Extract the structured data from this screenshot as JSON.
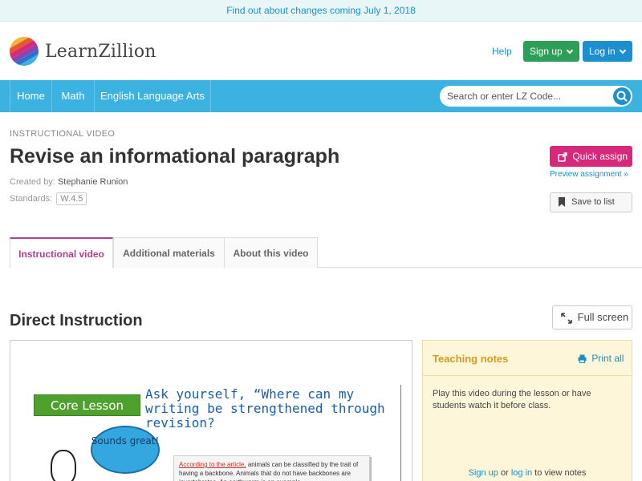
{
  "banner": {
    "text": "Find out about changes coming July 1, 2018"
  },
  "header": {
    "logo_text": "LearnZillion",
    "help": "Help",
    "signup": "Sign up",
    "login": "Log in"
  },
  "nav": {
    "items": [
      "Home",
      "Math",
      "English Language Arts"
    ],
    "search_placeholder": "Search or enter LZ Code..."
  },
  "lesson": {
    "eyebrow": "INSTRUCTIONAL VIDEO",
    "title": "Revise an informational paragraph",
    "created_label": "Created by:",
    "created_by": "Stephanie Runion",
    "standards_label": "Standards:",
    "standard": "W.4.5",
    "quick_assign": "Quick assign",
    "preview_assignment": "Preview assignment »",
    "save_to_list": "Save to list"
  },
  "tabs": [
    {
      "label": "Instructional video",
      "active": true
    },
    {
      "label": "Additional materials",
      "active": false
    },
    {
      "label": "About this video",
      "active": false
    }
  ],
  "section": {
    "title": "Direct Instruction",
    "full_screen": "Full screen"
  },
  "video": {
    "core_lesson": "Core Lesson",
    "prompt": "Ask yourself, “Where can my writing be strengthened through revision?",
    "bubble": "Sounds great!",
    "paper_highlight": "According to the article,",
    "paper_text": " animals can be classified by the trait of having a backbone. Animals that do not have backbones are invertebrates. An earthworm is an example"
  },
  "notes": {
    "title": "Teaching notes",
    "print_all": "Print all",
    "body": "Play this video during the lesson or have students watch it before class.",
    "foot_signup": "Sign up",
    "foot_or": " or ",
    "foot_login": "log in",
    "foot_rest": " to view notes"
  },
  "colors": {
    "nav_blue": "#3cb2e0",
    "signup_green": "#2e9f58",
    "login_blue": "#1d8fd1",
    "assign_pink": "#d8287a",
    "tab_active": "#b13e8f",
    "notes_title": "#d69a1b"
  },
  "icons": [
    "logo-stripes-icon",
    "chevron-down-icon",
    "search-icon",
    "share-icon",
    "bookmark-icon",
    "expand-icon",
    "printer-icon"
  ]
}
